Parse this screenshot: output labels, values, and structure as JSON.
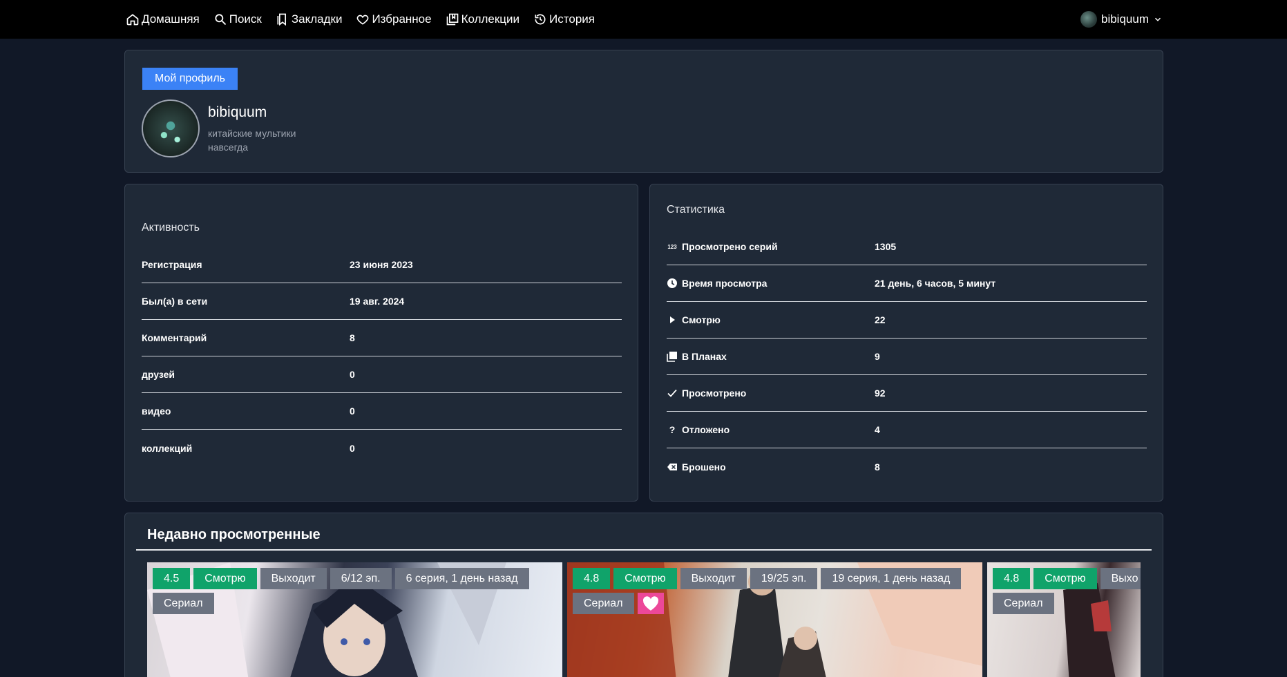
{
  "nav": {
    "links": [
      {
        "label": "Домашняя",
        "icon": "home-icon"
      },
      {
        "label": "Поиск",
        "icon": "search-icon"
      },
      {
        "label": "Закладки",
        "icon": "bookmark-icon"
      },
      {
        "label": "Избранное",
        "icon": "heart-icon"
      },
      {
        "label": "Коллекции",
        "icon": "collection-icon"
      },
      {
        "label": "История",
        "icon": "history-icon"
      }
    ],
    "username": "bibiquum"
  },
  "profile": {
    "tab_label": "Мой профиль",
    "name": "bibiquum",
    "bio": "китайские мультики навсегда"
  },
  "activity": {
    "title": "Активность",
    "rows": [
      {
        "label": "Регистрация",
        "value": "23 июня 2023"
      },
      {
        "label": "Был(а) в сети",
        "value": "19 авг. 2024"
      },
      {
        "label": "Комментарий",
        "value": "8"
      },
      {
        "label": "друзей",
        "value": "0"
      },
      {
        "label": "видео",
        "value": "0"
      },
      {
        "label": "коллекций",
        "value": "0"
      }
    ]
  },
  "stats": {
    "title": "Статистика",
    "rows": [
      {
        "label": "Просмотрено серий",
        "value": "1305",
        "icon": "numbers-icon"
      },
      {
        "label": "Время просмотра",
        "value": "21 день, 6 часов, 5 минут",
        "icon": "clock-icon"
      },
      {
        "label": "Смотрю",
        "value": "22",
        "icon": "play-icon"
      },
      {
        "label": "В Планах",
        "value": "9",
        "icon": "plans-icon"
      },
      {
        "label": "Просмотрено",
        "value": "92",
        "icon": "check-icon"
      },
      {
        "label": "Отложено",
        "value": "4",
        "icon": "question-icon"
      },
      {
        "label": "Брошено",
        "value": "8",
        "icon": "dropped-icon"
      }
    ]
  },
  "recent": {
    "title": "Недавно просмотренные",
    "items": [
      {
        "rating": "4.5",
        "status": "Смотрю",
        "state": "Выходит",
        "episodes": "6/12 эп.",
        "last": "6 серия, 1 день назад",
        "kind": "Сериал"
      },
      {
        "rating": "4.8",
        "status": "Смотрю",
        "state": "Выходит",
        "episodes": "19/25 эп.",
        "last": "19 серия, 1 день назад",
        "kind": "Сериал"
      },
      {
        "rating": "4.8",
        "status": "Смотрю",
        "state": "Выхо",
        "kind": "Сериал"
      }
    ]
  },
  "colors": {
    "accent": "#3b82f6",
    "badge_green": "#10a36a",
    "badge_gray": "#6b7280",
    "favorite_pink": "#ec4899"
  }
}
